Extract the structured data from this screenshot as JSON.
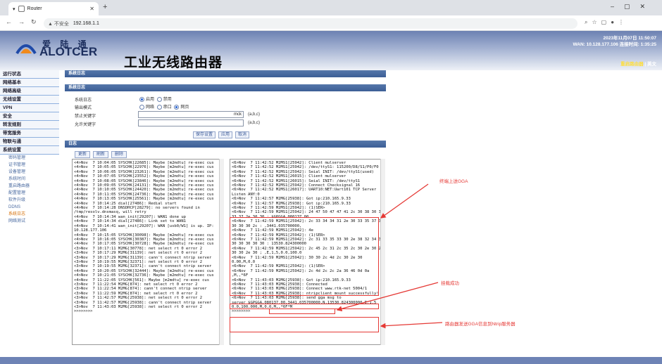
{
  "browser": {
    "tab_title": "Router",
    "new_tab_icon": "plus-icon",
    "security_label": "▲ 不安全",
    "url": "192.168.1.1"
  },
  "header": {
    "brand_cn": "爱 陆 通",
    "brand_en": "ALOTCER",
    "page_title": "工业无线路由器",
    "datetime": "2023年11月07日 11:50:07",
    "wan_info": "WAN: 10.128.177.106   连接时间: 1:35:25",
    "reboot_link": "重启路由器",
    "separator": " | ",
    "lang_link": "英文"
  },
  "sidebar": {
    "items": [
      "运行状态",
      "网络基本",
      "网络高级",
      "无线设置",
      "VPN",
      "安全",
      "转发规则",
      "带宽服务",
      "物联与通",
      "系统设置"
    ],
    "subitems": [
      "密码管理",
      "证书管理",
      "设备管理",
      "系统时间",
      "重启路由器",
      "配置管理",
      "软件升级",
      "DDNS",
      "系统日志",
      "网络测试"
    ]
  },
  "main": {
    "section_title": "系统日志",
    "log_settings_title": "系统日志",
    "syslog_label": "系统日志",
    "enable_label": "启用",
    "disable_label": "禁用",
    "output_label": "输出模式",
    "out_network": "网络",
    "out_serial": "串口",
    "out_web": "网页",
    "forbid_label": "禁止关键字",
    "forbid_value": "mck",
    "forbid_hint": "(a,b,c)",
    "allow_label": "允许关键字",
    "allow_value": "",
    "allow_hint": "(a,b,c)",
    "save_btn": "保存设置",
    "apply_btn": "应用",
    "cancel_btn": "取消",
    "log_title": "日志",
    "update_btn": "更新",
    "clear_btn": "刷新",
    "delete_btn": "删除"
  },
  "logs": {
    "left": "<4>Nov  7 10:04:05 SYSCHK[22685]: Maybe [m2mdtu] re-exec cus\n<4>Nov  7 10:05:05 SYSCHK[22976]: Maybe [m2mdtu] re-exec cus\n<4>Nov  7 10:06:05 SYSCHK[23261]: Maybe [m2mdtu] re-exec cus\n<4>Nov  7 10:07:05 SYSCHK[23552]: Maybe [m2mdtu] re-exec cus\n<4>Nov  7 10:08:05 SYSCHK[23846]: Maybe [m2mdtu] re-exec cus\n<4>Nov  7 10:09:05 SYSCHK[24131]: Maybe [m2mdtu] re-exec cus\n<4>Nov  7 10:10:05 SYSCHK[24420]: Maybe [m2mdtu] re-exec cus\n<4>Nov  7 10:11:05 SYSCHK[24736]: Maybe [m2mdtu] re-exec cus\n<4>Nov  7 10:13:05 SYSCHK[25561]: Maybe [m2mdtu] re-exec cus\n<4>Nov  7 10:14:25 dial[27486]: Redial start\n<4>Nov  7 10:14:28 DNSDHCP[28279]: no servers found in\n/tmp/resolv.dnsmasq, will retry\n<4>Nov  7 10:14:34 wan_init[29207]: WAN1 done up\n<4>Nov  7 10:14:34 dial[27486]: Link set to WAN1\n<4>Nov  7 10:14:41 wan_init[29207]: WAN [usb0/W1] is up. IP:\n10.128.177.106\n<4>Nov  7 10:15:05 SYSCHK[30098]: Maybe [m2mdtu] re-exec cus\n<4>Nov  7 10:16:05 SYSCHK[30387]: Maybe [m2mdtu] re-exec cus\n<4>Nov  7 10:17:05 SYSCHK[30728]: Maybe [m2mdtu] re-exec cus\n<3>Nov  7 10:17:11 M2MG[30778]: net select rt 0 error 2\n<3>Nov  7 10:17:29 M2MG[31139]: net select rt 0 error 2\n<3>Nov  7 10:17:29 M2MG[31139]: cann't connect ntrip server\n<3>Nov  7 10:19:55 M2MG[32371]: net select rt 0 error 2\n<3>Nov  7 10:19:55 M2MG[32371]: cann't connect ntrip server\n<4>Nov  7 10:20:05 SYSCHK[32444]: Maybe [m2mdtu] re-exec cus\n<4>Nov  7 10:21:05 SYSCHK[32736]: Maybe [m2mdtu] re-exec cus\n<4>Nov  7 11:22:05 SYSCHK[561]: Maybe [m2mdtu] re-exec cus\n<3>Nov  7 11:22:54 M2MG[874]: net select rt 0 error 2\n<3>Nov  7 11:22:54 M2MG[874]: cann't connect ntrip server\n<3>Nov  7 11:22:59 M2MG[874]: net select rt 0 error 2\n<3>Nov  7 11:42:57 M2MG[25938]: net select rt 0 error 2\n<3>Nov  7 11:42:57 M2MG[25938]: cann't connect ntrip server\n<3>Nov  7 11:43:03 M2MG[25938]: net select rt 0 error 2\n>>>>>>>>",
    "right": "<6>Nov  7 11:42:52 M2MS1[25942]: Client mulserver\n<6>Nov  7 11:42:52 M2MS1[25942]: /dev/ttyS1: 115200/D8/S1/P0/F0\n<6>Nov  7 11:42:52 M2MS1[25942]: Seial INIT: /dev/ttyS1(used)\n<6>Nov  7 11:42:52 M2MS1[26015]: Client mulserver\n<6>Nov  7 11:42:52 M2MS1[26015]: Seial INIT: /dev/ttyS1\n<6>Nov  7 11:42:52 M2MS1[25942]: Connect Checksignal 16\n<6>Nov  7 11:42:52 M2MS1[26017]: UART10:NET:Uart101 TCP Server\nListen ANY:0\n<6>Nov  7 11:42:57 M2MG[25938]: Got ip:210.165.9.33\n<6>Nov  7 11:42:57 M2MG[25938]: Got ip:210.165.9.33\n<6>Nov  7 11:42:59 M2MS1[25942]: (1)SER>\n<6>Nov  7 11:42:59 M2MS1[25942]: 24 47 50 47 47 41 2c 30 38 30 31\n33 37 2e 30 30 : $GPGGA,080137.00\n<6>Nov  7 11:42:59 M2MS1[25942]: 2c 33 34 34 31 2e 30 33 35 37 30\n30 30 30 2c : ,3441.035700000,\n<6>Nov  7 11:42:59 M2MS1[25942]: 4e                              | N\n<6>Nov  7 11:42:59 M2MS1[25942]: (1)SER>\n<6>Nov  7 11:42:59 M2MS1[25942]: 2c 31 33 35 33 30 2e 38 32 34 33\n30 30 30 30 30 : 13530.824300000\n<6>Nov  7 11:42:59 M2MS1[25942]: 2c 45 2c 31 2c 35 2c 30 2e 30 2c 31\n30 30 2e 30 ; ,E,1,5,0.0,100.0\n<6>Nov  7 11:42:59 M2MS1[25942]: 30 30 2c 4d 2c 30 2e 30\n0.00,M,0.0\n<6>Nov  7 11:42:59 M2MS1[25942]: (1)SER>\n<6>Nov  7 11:42:59 M2MS1[25942]: 2c 4d 2c 2c 2a 36 46 0d 0a\n,M,,*6F\n<6>Nov  7 11:43:03 M2MG[25938]: Got ip:210.165.9.33\n<6>Nov  7 11:43:03 M2MG[25938]: Connected\n<6>Nov  7 11:43:03 M2MG[25938]: Connect www.rtk-net 5004/1\n<6>Nov  7 11:43:03 M2MG[25938]: ntripclient mount successfully!\n<6>Nov  7 11:43:03 M2MG[25938]: send gga msg to\nserver $GPGGA,080137.00,3441.035700000,N,13530.824300000,E,1,5\n0.0,100.000,M,0.0,M,,*6F*M\n>>>>>>>>"
  },
  "annotations": {
    "gga_upload": "终端上送GGA",
    "mount_ok": "挂载成功",
    "router_send": "路由器发送GGA信息到Ntrip服务器"
  },
  "colors": {
    "header_top": "#6c81b2",
    "menu_bar": "#3c5e96",
    "annotation": "#e53935",
    "footer": "#6e83b5"
  }
}
